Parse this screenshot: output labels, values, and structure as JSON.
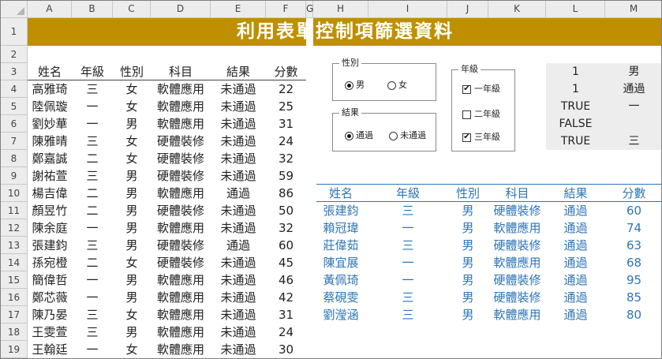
{
  "columns": [
    "A",
    "B",
    "C",
    "D",
    "E",
    "F",
    "G",
    "H",
    "I",
    "J",
    "K",
    "L",
    "M"
  ],
  "rows": [
    "1",
    "2",
    "3",
    "4",
    "5",
    "6",
    "7",
    "8",
    "9",
    "10",
    "11",
    "12",
    "13",
    "14",
    "15",
    "16",
    "17",
    "18",
    "19"
  ],
  "title": "利用表單控制項篩選資料",
  "source_table": {
    "headers": [
      "姓名",
      "年級",
      "性別",
      "科目",
      "結果",
      "分數"
    ],
    "rows": [
      [
        "高雅琦",
        "三",
        "女",
        "軟體應用",
        "未通過",
        "22"
      ],
      [
        "陸佩璇",
        "一",
        "女",
        "軟體應用",
        "未通過",
        "25"
      ],
      [
        "劉妙華",
        "一",
        "男",
        "軟體應用",
        "未通過",
        "31"
      ],
      [
        "陳雅晴",
        "三",
        "女",
        "硬體裝修",
        "未通過",
        "24"
      ],
      [
        "鄭嘉誠",
        "二",
        "女",
        "硬體裝修",
        "未通過",
        "32"
      ],
      [
        "謝祐萱",
        "三",
        "男",
        "硬體裝修",
        "未通過",
        "59"
      ],
      [
        "楊吉偉",
        "二",
        "男",
        "軟體應用",
        "通過",
        "86"
      ],
      [
        "顏昱竹",
        "二",
        "男",
        "硬體裝修",
        "未通過",
        "50"
      ],
      [
        "陳余庭",
        "一",
        "男",
        "軟體應用",
        "未通過",
        "32"
      ],
      [
        "張建鈞",
        "三",
        "男",
        "硬體裝修",
        "通過",
        "60"
      ],
      [
        "孫宛橙",
        "二",
        "女",
        "硬體裝修",
        "未通過",
        "45"
      ],
      [
        "簡偉哲",
        "一",
        "男",
        "軟體應用",
        "未通過",
        "46"
      ],
      [
        "鄭芯薇",
        "一",
        "男",
        "軟體應用",
        "未通過",
        "42"
      ],
      [
        "陳乃晏",
        "三",
        "女",
        "軟體應用",
        "未通過",
        "31"
      ],
      [
        "王雯萱",
        "三",
        "男",
        "軟體應用",
        "未通過",
        "24"
      ],
      [
        "王翰廷",
        "一",
        "女",
        "軟體應用",
        "未通過",
        "30"
      ]
    ]
  },
  "controls": {
    "gender": {
      "title": "性別",
      "options": [
        {
          "label": "男",
          "selected": true
        },
        {
          "label": "女",
          "selected": false
        }
      ]
    },
    "result": {
      "title": "結果",
      "options": [
        {
          "label": "通過",
          "selected": true
        },
        {
          "label": "未通過",
          "selected": false
        }
      ]
    },
    "grade": {
      "title": "年級",
      "options": [
        {
          "label": "一年級",
          "checked": true
        },
        {
          "label": "二年級",
          "checked": false
        },
        {
          "label": "三年級",
          "checked": true
        }
      ]
    }
  },
  "linked_cells": {
    "L": [
      "1",
      "1",
      "TRUE",
      "FALSE",
      "TRUE"
    ],
    "M": [
      "男",
      "通過",
      "一",
      "",
      "三"
    ]
  },
  "filtered_table": {
    "headers": [
      "姓名",
      "年級",
      "性別",
      "科目",
      "結果",
      "分數"
    ],
    "rows": [
      [
        "張建鈞",
        "三",
        "男",
        "硬體裝修",
        "通過",
        "60"
      ],
      [
        "賴冠瑋",
        "一",
        "男",
        "軟體應用",
        "通過",
        "74"
      ],
      [
        "莊偉茹",
        "三",
        "男",
        "硬體裝修",
        "通過",
        "63"
      ],
      [
        "陳宜展",
        "一",
        "男",
        "軟體應用",
        "通過",
        "68"
      ],
      [
        "黃佩琦",
        "一",
        "男",
        "硬體裝修",
        "通過",
        "95"
      ],
      [
        "蔡硯雯",
        "三",
        "男",
        "硬體裝修",
        "通過",
        "85"
      ],
      [
        "劉瀅涵",
        "三",
        "男",
        "軟體應用",
        "通過",
        "80"
      ]
    ]
  },
  "colors": {
    "title_bg": "#bf8f00",
    "filtered_text": "#2e75b6",
    "linked_bg": "#ededed"
  }
}
